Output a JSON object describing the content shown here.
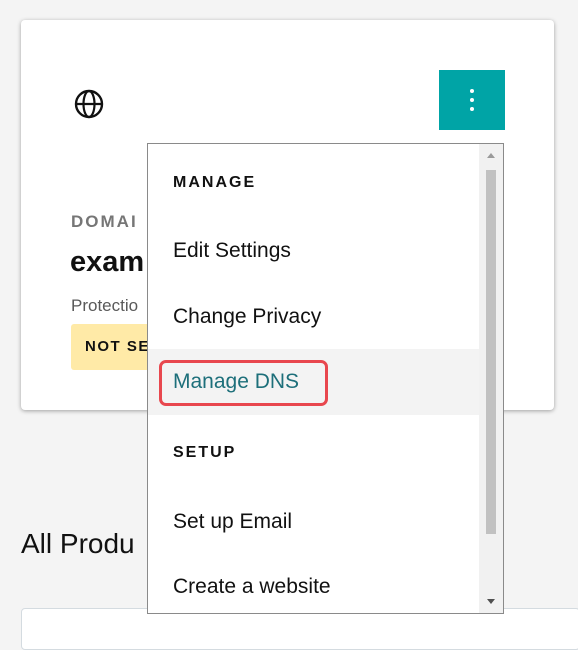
{
  "card": {
    "domain_label": "DOMAI",
    "domain_name": "exam",
    "protection_text": "Protectio",
    "status_badge": "NOT SE"
  },
  "page": {
    "section_title": "All Produ"
  },
  "menu": {
    "manage_header": "MANAGE",
    "edit_settings": "Edit Settings",
    "change_privacy": "Change Privacy",
    "manage_dns": "Manage DNS",
    "setup_header": "SETUP",
    "set_up_email": "Set up Email",
    "create_website": "Create a website",
    "scroll_position": 0
  },
  "colors": {
    "accent": "#00a4a6",
    "badge_bg": "#ffeaa7",
    "highlight_link": "#1d6f7a",
    "annotation_red": "#e8474e"
  },
  "icons": {
    "domain": "globe-icon",
    "actions": "kebab-menu-icon"
  }
}
